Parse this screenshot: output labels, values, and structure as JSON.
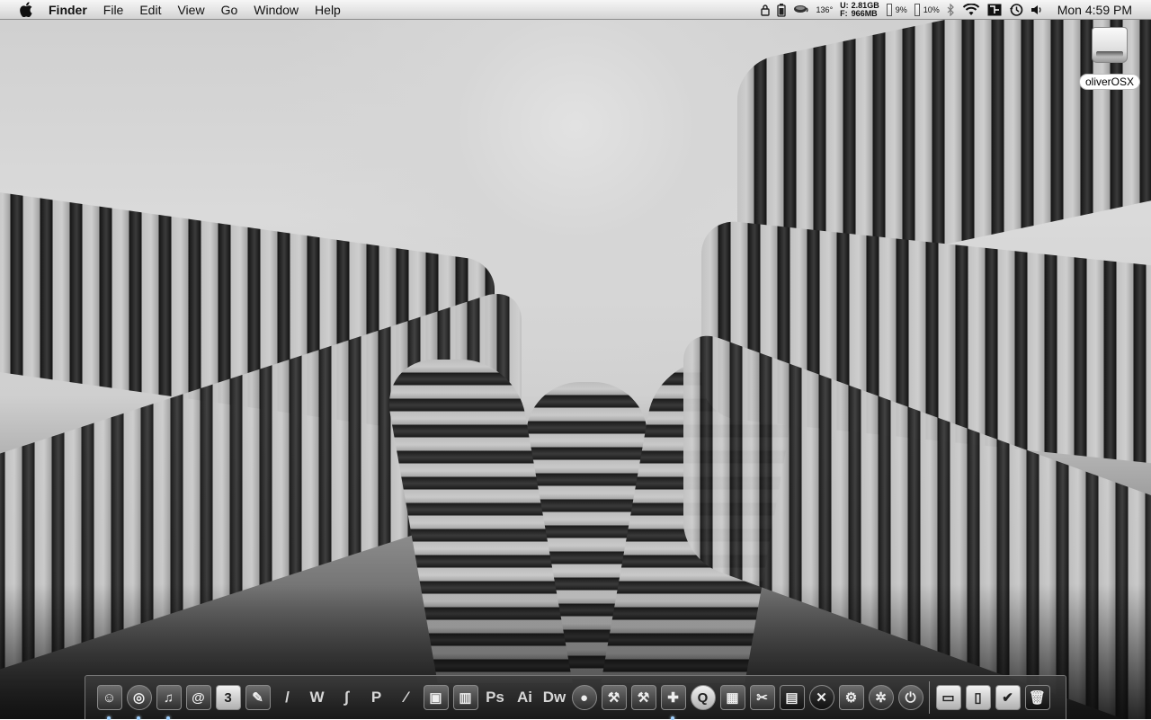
{
  "menubar": {
    "app_name": "Finder",
    "menus": [
      "File",
      "Edit",
      "View",
      "Go",
      "Window",
      "Help"
    ],
    "status": {
      "temperature": "136°",
      "disk_used_label": "U:",
      "disk_used": "2.81GB",
      "disk_free_label": "F:",
      "disk_free": "966MB",
      "cpu1": "9%",
      "cpu2": "10%",
      "clock": "Mon 4:59 PM"
    },
    "status_icons": [
      "lock-icon",
      "battery-icon",
      "coffee-cup-icon",
      "bluetooth-icon",
      "wifi-icon",
      "display-icon",
      "time-machine-icon",
      "volume-icon"
    ]
  },
  "desktop": {
    "wallpaper": "black-and-white curved high-rise towers",
    "icons": [
      {
        "label": "oliverOSX",
        "icon": "hard-drive-icon"
      }
    ]
  },
  "dock": {
    "items": [
      {
        "name": "finder",
        "icon": "finder-icon",
        "glyph": "☺",
        "running": true
      },
      {
        "name": "safari",
        "icon": "globe-icon",
        "glyph": "◎",
        "running": true,
        "round": true
      },
      {
        "name": "itunes",
        "icon": "music-note-icon",
        "glyph": "♫",
        "running": true
      },
      {
        "name": "mail",
        "icon": "at-sign-icon",
        "glyph": "@",
        "running": false
      },
      {
        "name": "ical",
        "icon": "calendar-icon",
        "glyph": "3",
        "running": false,
        "light": true
      },
      {
        "name": "notes",
        "icon": "notepad-icon",
        "glyph": "✎",
        "running": false
      },
      {
        "name": "textedit",
        "icon": "document-pen-icon",
        "glyph": "/",
        "running": false,
        "text": true
      },
      {
        "name": "app-w",
        "icon": "w-glyph-icon",
        "glyph": "W",
        "running": false,
        "text": true
      },
      {
        "name": "app-script",
        "icon": "swirl-icon",
        "glyph": "∫",
        "running": false,
        "text": true
      },
      {
        "name": "app-p",
        "icon": "p-glyph-icon",
        "glyph": "P",
        "running": false,
        "text": true
      },
      {
        "name": "brush",
        "icon": "brush-icon",
        "glyph": "⁄",
        "running": false,
        "text": true
      },
      {
        "name": "preview",
        "icon": "photos-icon",
        "glyph": "▣",
        "running": false
      },
      {
        "name": "app-chart",
        "icon": "chart-icon",
        "glyph": "▥",
        "running": false
      },
      {
        "name": "photoshop",
        "icon": "photoshop-icon",
        "glyph": "Ps",
        "running": false,
        "text": true
      },
      {
        "name": "illustrator",
        "icon": "illustrator-icon",
        "glyph": "Ai",
        "running": false,
        "text": true
      },
      {
        "name": "dreamweaver",
        "icon": "dreamweaver-icon",
        "glyph": "Dw",
        "running": false,
        "text": true
      },
      {
        "name": "globe-app",
        "icon": "sphere-icon",
        "glyph": "●",
        "running": false,
        "round": true
      },
      {
        "name": "utility",
        "icon": "tools-icon",
        "glyph": "⚒",
        "running": false
      },
      {
        "name": "xcode",
        "icon": "hammer-icon",
        "glyph": "⚒",
        "running": false
      },
      {
        "name": "app-cross",
        "icon": "cross-icon",
        "glyph": "✚",
        "running": true
      },
      {
        "name": "quicktime",
        "icon": "quicktime-icon",
        "glyph": "Q",
        "running": false,
        "round": true,
        "light": true
      },
      {
        "name": "imovie",
        "icon": "film-icon",
        "glyph": "▦",
        "running": false
      },
      {
        "name": "clapper",
        "icon": "clapper-icon",
        "glyph": "✂",
        "running": false
      },
      {
        "name": "calculator",
        "icon": "calculator-icon",
        "glyph": "▤",
        "running": false,
        "dark": true
      },
      {
        "name": "app-x",
        "icon": "x-orb-icon",
        "glyph": "✕",
        "running": false,
        "round": true,
        "dark": true
      },
      {
        "name": "system-preferences",
        "icon": "gears-icon",
        "glyph": "⚙",
        "running": false
      },
      {
        "name": "app-triskele",
        "icon": "triskele-icon",
        "glyph": "✲",
        "running": false,
        "round": true
      },
      {
        "name": "power",
        "icon": "power-icon",
        "glyph": "⏻",
        "running": false,
        "round": true
      }
    ],
    "stack_items": [
      {
        "name": "documents-stack",
        "icon": "documents-stack-icon",
        "glyph": "▭",
        "light": true
      },
      {
        "name": "downloads-stack",
        "icon": "downloads-stack-icon",
        "glyph": "▯",
        "light": true
      },
      {
        "name": "checklist-stack",
        "icon": "checklist-icon",
        "glyph": "✔",
        "light": true
      },
      {
        "name": "trash",
        "icon": "trash-icon",
        "glyph": "🗑",
        "dark": true
      }
    ]
  }
}
